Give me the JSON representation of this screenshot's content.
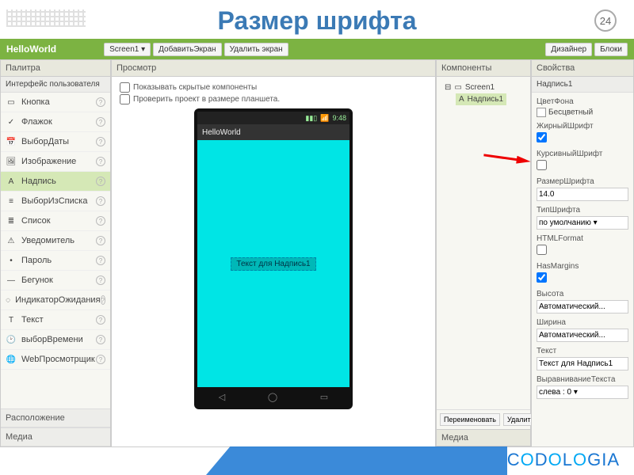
{
  "slide": {
    "title": "Размер шрифта",
    "number": "24"
  },
  "topbar": {
    "project": "HelloWorld",
    "screen_btn": "Screen1 ▾",
    "add_screen": "ДобавитьЭкран",
    "remove_screen": "Удалить экран",
    "designer": "Дизайнер",
    "blocks": "Блоки"
  },
  "palette": {
    "head": "Палитра",
    "cat_ui": "Интерфейс пользователя",
    "items": [
      {
        "label": "Кнопка",
        "icon": "▭"
      },
      {
        "label": "Флажок",
        "icon": "✓"
      },
      {
        "label": "ВыборДаты",
        "icon": "📅"
      },
      {
        "label": "Изображение",
        "icon": "🖼"
      },
      {
        "label": "Надпись",
        "icon": "A",
        "sel": true
      },
      {
        "label": "ВыборИзСписка",
        "icon": "≡"
      },
      {
        "label": "Список",
        "icon": "≣"
      },
      {
        "label": "Уведомитель",
        "icon": "⚠"
      },
      {
        "label": "Пароль",
        "icon": "•"
      },
      {
        "label": "Бегунок",
        "icon": "—"
      },
      {
        "label": "ИндикаторОжидания",
        "icon": "◌"
      },
      {
        "label": "Текст",
        "icon": "T"
      },
      {
        "label": "выборВремени",
        "icon": "🕑"
      },
      {
        "label": "WebПросмотрщик",
        "icon": "🌐"
      }
    ],
    "cat_layout": "Расположение",
    "cat_media": "Медиа"
  },
  "viewer": {
    "head": "Просмотр",
    "show_hidden": "Показывать скрытые компоненты",
    "tablet_preview": "Проверить проект в размере планшета.",
    "status_time": "9:48",
    "appbar": "HelloWorld",
    "label_text": "Текст для Надпись1"
  },
  "components": {
    "head": "Компоненты",
    "root": "Screen1",
    "child": "Надпись1",
    "rename": "Переименовать",
    "delete": "Удалить",
    "media_head": "Медиа"
  },
  "properties": {
    "head": "Свойства",
    "target": "Надпись1",
    "bg_label": "ЦветФона",
    "bg_value": "Бесцветный",
    "bold_label": "ЖирныйШрифт",
    "bold_checked": true,
    "italic_label": "КурсивныйШрифт",
    "italic_checked": false,
    "fontsize_label": "РазмерШрифта",
    "fontsize_value": "14.0",
    "typeface_label": "ТипШрифта",
    "typeface_value": "по умолчанию ▾",
    "htmlfmt_label": "HTMLFormat",
    "htmlfmt_checked": false,
    "hasmargins_label": "HasMargins",
    "hasmargins_checked": true,
    "height_label": "Высота",
    "height_value": "Автоматический...",
    "width_label": "Ширина",
    "width_value": "Автоматический...",
    "text_label": "Текст",
    "text_value": "Текст для Надпись1",
    "align_label": "ВыравниваниеТекста",
    "align_value": "слева : 0 ▾"
  },
  "footer": {
    "logo": "CODOLOGIA"
  }
}
